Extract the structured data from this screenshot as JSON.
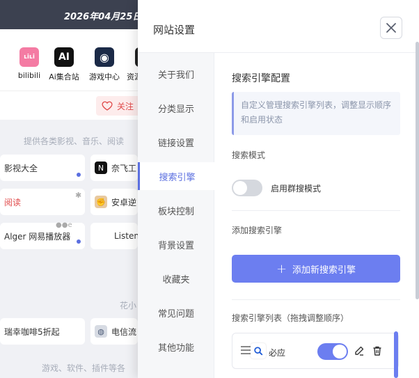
{
  "background": {
    "date": "2026年04月25日",
    "apps": [
      {
        "label": "bilibili",
        "icon": "bilibili-icon",
        "glyph": "ʟiʟi",
        "color": "#f47ba3"
      },
      {
        "label": "Ai集合站",
        "icon": "ai-icon",
        "glyph": "AI",
        "color": "#111111"
      },
      {
        "label": "游戏中心",
        "icon": "steam-icon",
        "glyph": "◉",
        "color": "#1b2a47"
      },
      {
        "label": "资源",
        "icon": "resource-icon",
        "glyph": "▪",
        "color": "#222222"
      }
    ],
    "follow_label": "关注",
    "captions": {
      "c1": "提供各类影视、音乐、阅读",
      "c2": "花小",
      "c3": "游戏、软件、插件等各"
    },
    "cards": {
      "video": "影视大全",
      "naifei": "奈飞工",
      "read": "阅读",
      "android": "安卓逆",
      "alger": "Alger 网易播放器",
      "listen": "Listen",
      "coffee": "瑞幸咖啡5折起",
      "telecom": "电信流"
    }
  },
  "panel": {
    "title": "网站设置",
    "nav": [
      {
        "label": "关于我们",
        "active": false
      },
      {
        "label": "分类显示",
        "active": false
      },
      {
        "label": "链接设置",
        "active": false
      },
      {
        "label": "搜索引擎",
        "active": true
      },
      {
        "label": "板块控制",
        "active": false
      },
      {
        "label": "背景设置",
        "active": false
      },
      {
        "label": "收藏夹",
        "active": false
      },
      {
        "label": "常见问题",
        "active": false
      },
      {
        "label": "其他功能",
        "active": false
      }
    ],
    "section_title": "搜索引擎配置",
    "note": "自定义管理搜索引擎列表，调整显示顺序和启用状态",
    "search_mode_label": "搜索模式",
    "group_search_toggle_label": "启用群搜模式",
    "group_search_enabled": false,
    "add_label": "添加搜索引擎",
    "add_button_label": "添加新搜索引擎",
    "list_label": "搜索引擎列表（拖拽调整顺序）",
    "engines": [
      {
        "name": "必应",
        "enabled": true
      }
    ],
    "accent_color": "#6c7ef0"
  }
}
